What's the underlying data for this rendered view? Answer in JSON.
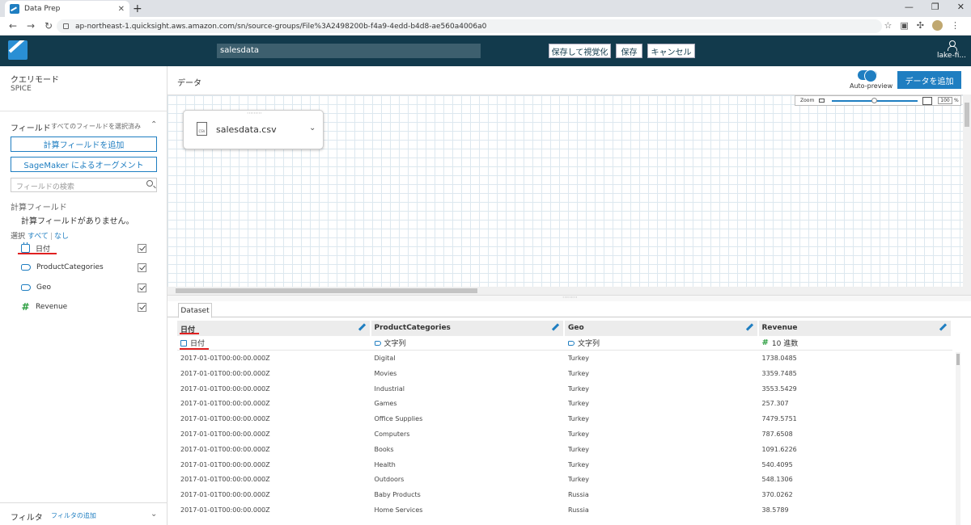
{
  "browser": {
    "tab_title": "Data Prep",
    "tab_close": "✕",
    "new_tab": "+",
    "url": "ap-northeast-1.quicksight.aws.amazon.com/sn/source-groups/File%3A2498200b-f4a9-4edd-b4d8-ae560a4006a0",
    "window_controls": [
      "—",
      "❐",
      "✕"
    ]
  },
  "header": {
    "dataset_name": "salesdata",
    "save_publish_label": "保存して視覚化",
    "save_label": "保存",
    "cancel_label": "キャンセル",
    "user_label": "lake-fi..."
  },
  "left_panel": {
    "query_mode_title": "クエリモード",
    "query_mode_value": "SPICE",
    "fields_title": "フィールド",
    "fields_subtitle": "すべてのフィールドを選択済み",
    "add_calc_label": "計算フィールドを追加",
    "sagemaker_label": "SageMaker によるオーグメント",
    "search_placeholder": "フィールドの検索",
    "calc_fields_title": "計算フィールド",
    "calc_fields_none": "計算フィールドがありません。",
    "select_label": "選択",
    "select_all": "すべて",
    "select_none": "なし",
    "fields": [
      {
        "name": "日付",
        "icon": "calendar-icon"
      },
      {
        "name": "ProductCategories",
        "icon": "string-tag-icon"
      },
      {
        "name": "Geo",
        "icon": "string-tag-icon"
      },
      {
        "name": "Revenue",
        "icon": "decimal-hash-icon"
      }
    ],
    "filter_title": "フィルタ",
    "filter_add": "フィルタの追加"
  },
  "main": {
    "data_title": "データ",
    "auto_preview_label": "Auto-preview",
    "add_data_label": "データを追加",
    "zoom_label": "Zoom",
    "zoom_value": "100",
    "zoom_unit": "%",
    "node_name": "salesdata.csv",
    "node_icon_text": "CSV"
  },
  "dataset": {
    "tab_label": "Dataset",
    "columns": [
      {
        "name": "日付",
        "type": "日付"
      },
      {
        "name": "ProductCategories",
        "type": "文字列"
      },
      {
        "name": "Geo",
        "type": "文字列"
      },
      {
        "name": "Revenue",
        "type": "10 進数"
      }
    ],
    "rows": [
      [
        "2017-01-01T00:00:00.000Z",
        "Digital",
        "Turkey",
        "1738.0485"
      ],
      [
        "2017-01-01T00:00:00.000Z",
        "Movies",
        "Turkey",
        "3359.7485"
      ],
      [
        "2017-01-01T00:00:00.000Z",
        "Industrial",
        "Turkey",
        "3553.5429"
      ],
      [
        "2017-01-01T00:00:00.000Z",
        "Games",
        "Turkey",
        "257.307"
      ],
      [
        "2017-01-01T00:00:00.000Z",
        "Office Supplies",
        "Turkey",
        "7479.5751"
      ],
      [
        "2017-01-01T00:00:00.000Z",
        "Computers",
        "Turkey",
        "787.6508"
      ],
      [
        "2017-01-01T00:00:00.000Z",
        "Books",
        "Turkey",
        "1091.6226"
      ],
      [
        "2017-01-01T00:00:00.000Z",
        "Health",
        "Turkey",
        "540.4095"
      ],
      [
        "2017-01-01T00:00:00.000Z",
        "Outdoors",
        "Turkey",
        "548.1306"
      ],
      [
        "2017-01-01T00:00:00.000Z",
        "Baby Products",
        "Russia",
        "370.0262"
      ],
      [
        "2017-01-01T00:00:00.000Z",
        "Home Services",
        "Russia",
        "38.5789"
      ]
    ]
  },
  "colors": {
    "header_bg": "#123a4c",
    "accent": "#1f7ec1",
    "annotation_red": "#e02020",
    "decimal_green": "#2a9d3e"
  }
}
